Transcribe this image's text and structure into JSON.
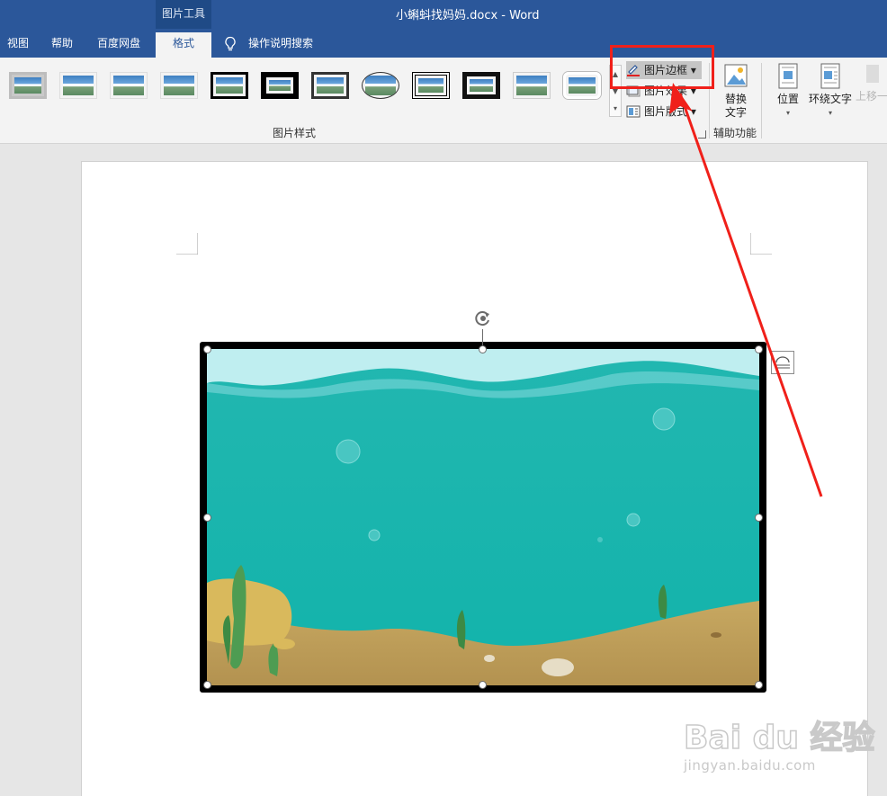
{
  "window": {
    "context_group": "图片工具",
    "document_title": "小蝌蚪找妈妈.docx  -  Word"
  },
  "tabs": [
    {
      "label": "视图"
    },
    {
      "label": "帮助"
    },
    {
      "label": "百度网盘"
    },
    {
      "label": "格式"
    },
    {
      "label": "操作说明搜索"
    }
  ],
  "ribbon": {
    "picture_styles_label": "图片样式",
    "gallery": [
      "simple-frame-white",
      "soft-edge",
      "reflected",
      "reflected-soft",
      "simple-frame-black",
      "thick-black-matte",
      "metal-frame",
      "oval-shadow",
      "double-frame-black",
      "thick-matte-black",
      "soft-edge-rect",
      "rounded-white"
    ],
    "border_cmd": "图片边框",
    "effects_cmd": "图片效果",
    "layout_cmd": "图片版式",
    "alt_text_line1": "替换",
    "alt_text_line2": "文字",
    "accessibility_label": "辅助功能",
    "position_label": "位置",
    "wrap_text_label": "环绕文字",
    "bring_forward_label": "上移一"
  },
  "watermark": {
    "brand": "Bai du 经验",
    "url": "jingyan.baidu.com"
  },
  "colors": {
    "title_bar": "#2b579a",
    "annotation_red": "#f0201a",
    "sea": "#17b5ae"
  }
}
